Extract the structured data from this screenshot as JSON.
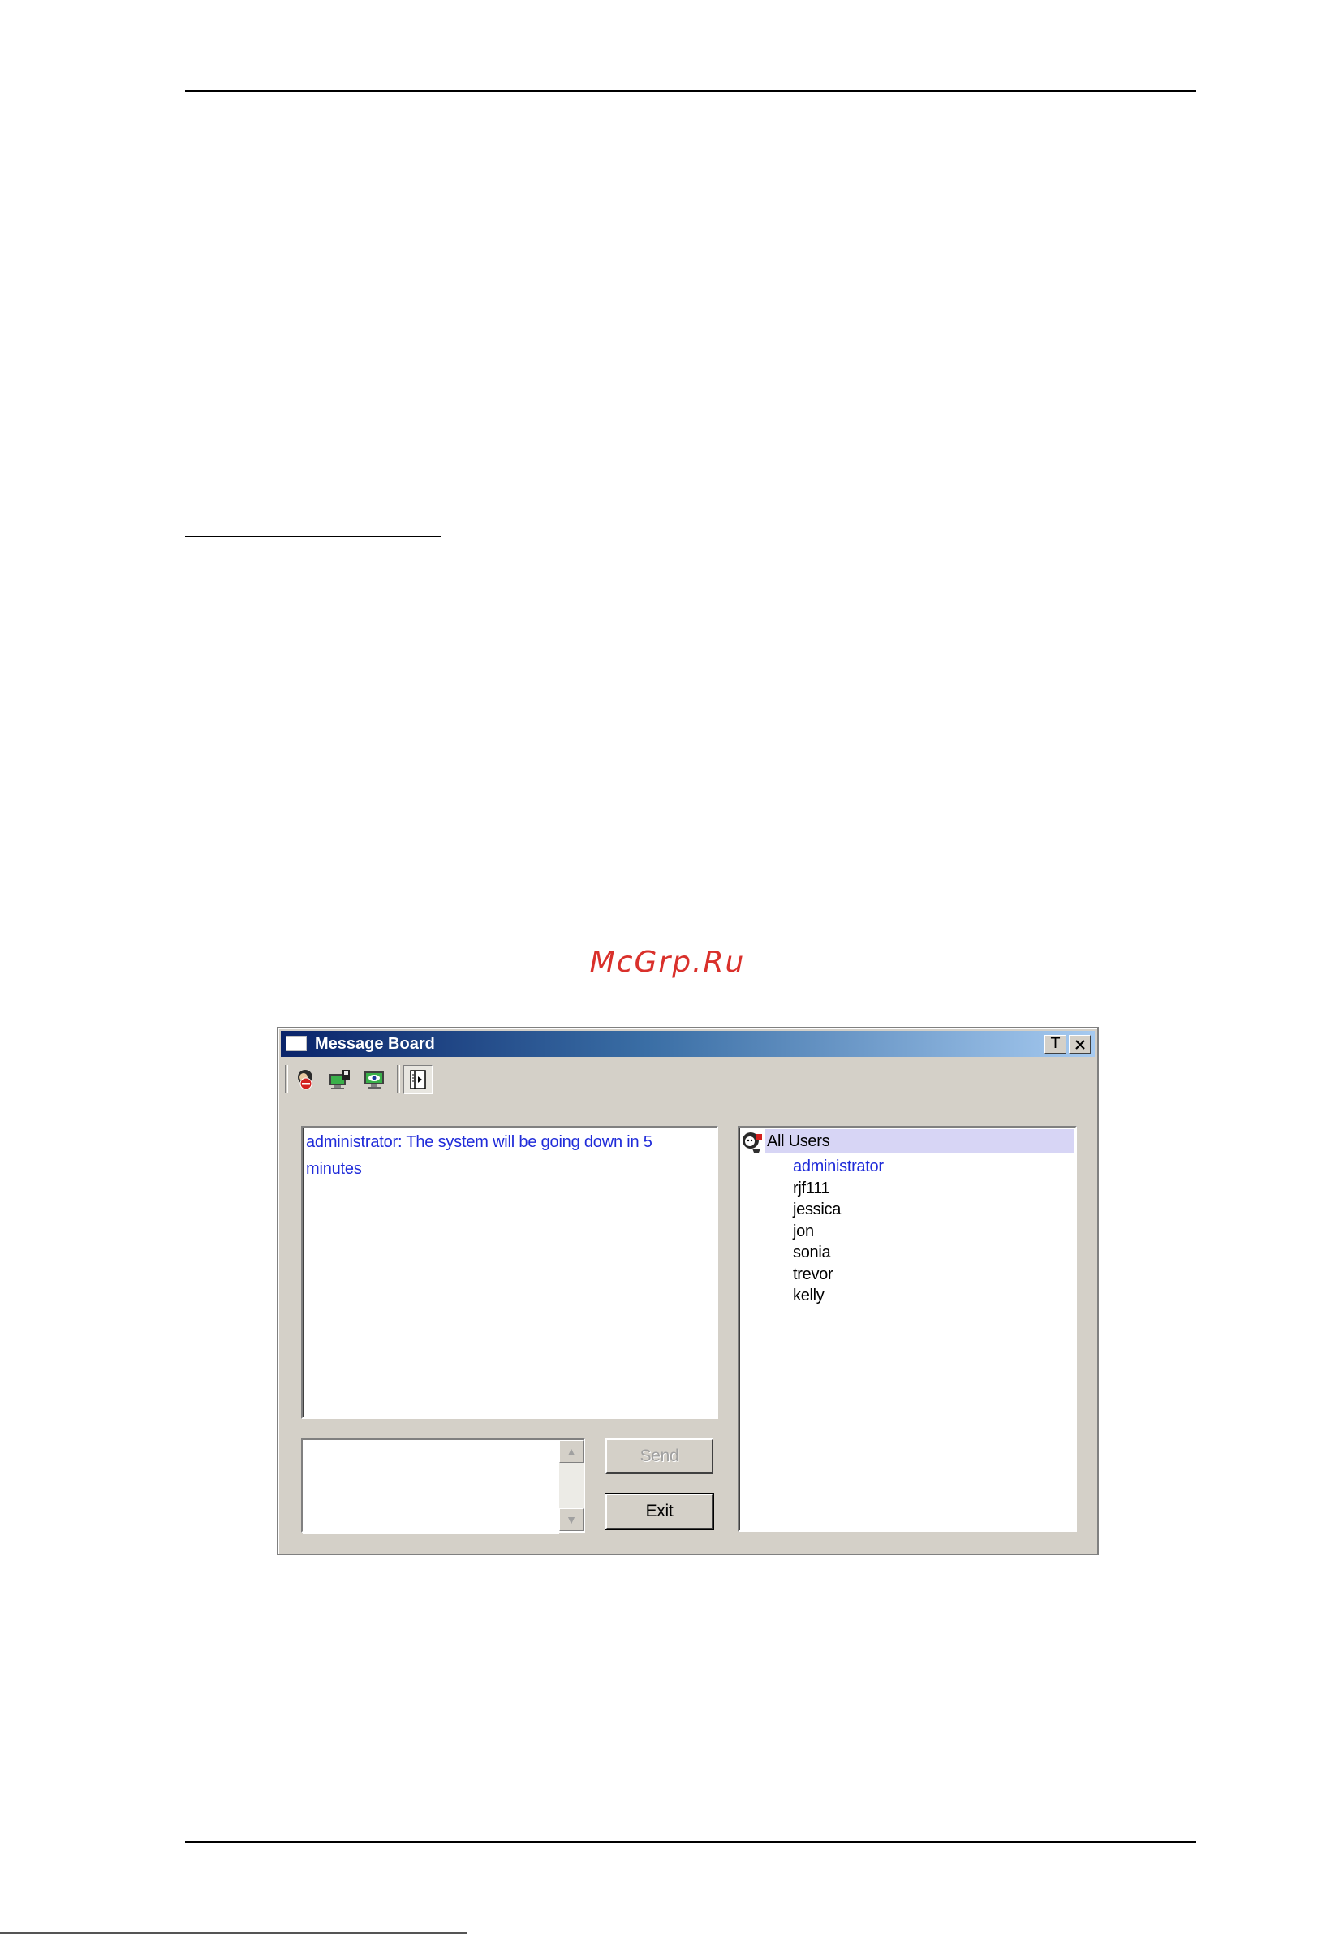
{
  "watermark": "McGrp.Ru",
  "window": {
    "title": "Message Board",
    "pin_label": "T",
    "close_label": "✕"
  },
  "toolbar": {
    "icons": [
      "do-not-disturb-icon",
      "occupy-icon",
      "observe-icon",
      "show-hide-user-list-icon"
    ]
  },
  "messages": {
    "text": "administrator: The system will be going down in 5 minutes"
  },
  "user_list": {
    "header": "All Users",
    "users": [
      "administrator",
      "rjf111",
      "jessica",
      "jon",
      "sonia",
      "trevor",
      "kelly"
    ]
  },
  "input": {
    "value": ""
  },
  "buttons": {
    "send": "Send",
    "exit": "Exit"
  },
  "colors": {
    "message_text": "#1f2bd9",
    "watermark": "#d9302b",
    "selected_row": "#d7d5f5"
  }
}
